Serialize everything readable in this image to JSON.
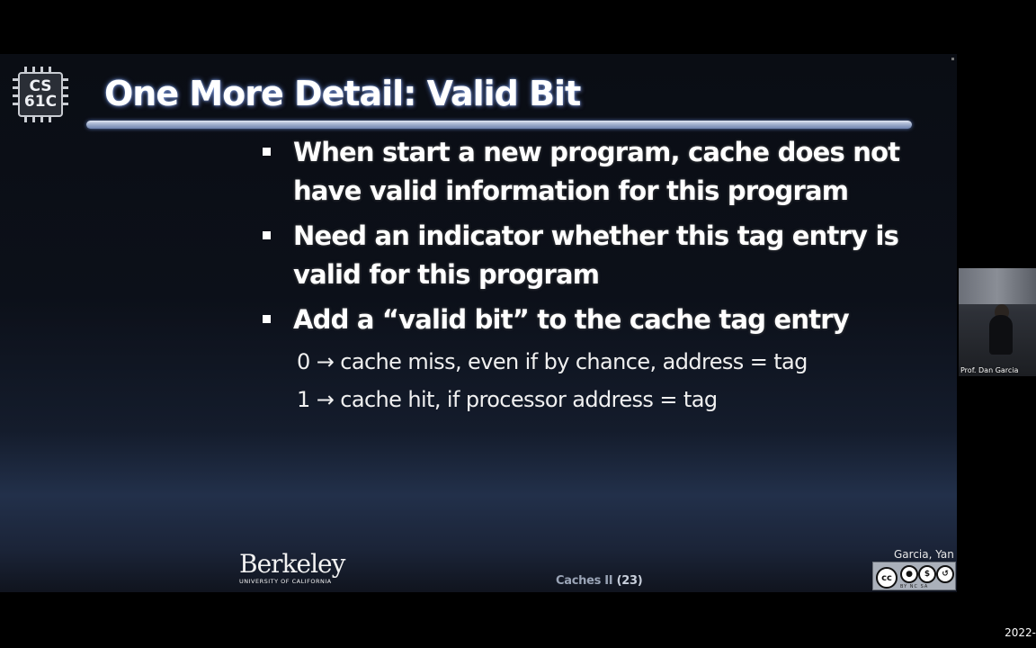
{
  "slide": {
    "logo_line1": "CS",
    "logo_line2": "61C",
    "title": "One More Detail: Valid Bit",
    "bullets": [
      "When start a new program, cache does not have valid information for this program",
      "Need an indicator whether this tag entry is valid for this program",
      "Add a “valid bit” to the cache tag entry"
    ],
    "sub_lines": [
      "0 → cache miss, even if by chance, address = tag",
      "1 → cache hit, if processor address = tag"
    ],
    "footer": {
      "brand": "Berkeley",
      "brand_sub": "UNIVERSITY OF CALIFORNIA",
      "section": "Caches II",
      "page": "(23)",
      "authors": "Garcia, Yan",
      "license_labels": "BY  NC  SA"
    }
  },
  "video": {
    "speaker_label": "Prof. Dan Garcia"
  },
  "overlay": {
    "date_fragment": "2022-"
  }
}
